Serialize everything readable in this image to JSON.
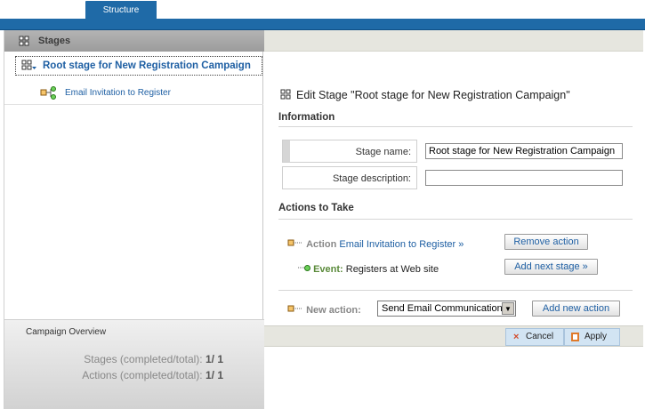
{
  "tabs": {
    "structure": "Structure"
  },
  "left_panel": {
    "header": "Stages",
    "tree": {
      "root_label": "Root stage for New Registration Campaign",
      "child_label": "Email Invitation to Register"
    },
    "overview": {
      "title": "Campaign Overview",
      "stages_label": "Stages (completed/total):",
      "stages_value": "1/ 1",
      "actions_label": "Actions (completed/total):",
      "actions_value": "1/ 1"
    }
  },
  "main": {
    "title": "Edit Stage \"Root stage for New Registration Campaign\"",
    "information_heading": "Information",
    "stage_name_label": "Stage name:",
    "stage_name_value": "Root stage for New Registration Campaign",
    "stage_description_label": "Stage description:",
    "stage_description_value": "",
    "actions_heading": "Actions to Take",
    "action_keyword": "Action",
    "action_link": "Email Invitation to Register »",
    "remove_action_button": "Remove action",
    "event_keyword": "Event:",
    "event_text": "Registers at Web site",
    "add_next_stage_button": "Add next stage »",
    "new_action_label": "New action:",
    "new_action_select_value": "Send Email Communication",
    "add_new_action_button": "Add new action",
    "cancel_button": "Cancel",
    "apply_button": "Apply"
  },
  "colors": {
    "brand_blue": "#1f6aa7",
    "link_blue": "#1e5fa3",
    "event_green": "#5a8a3a",
    "cancel_red": "#d24a2a",
    "apply_orange": "#e07a2a"
  }
}
